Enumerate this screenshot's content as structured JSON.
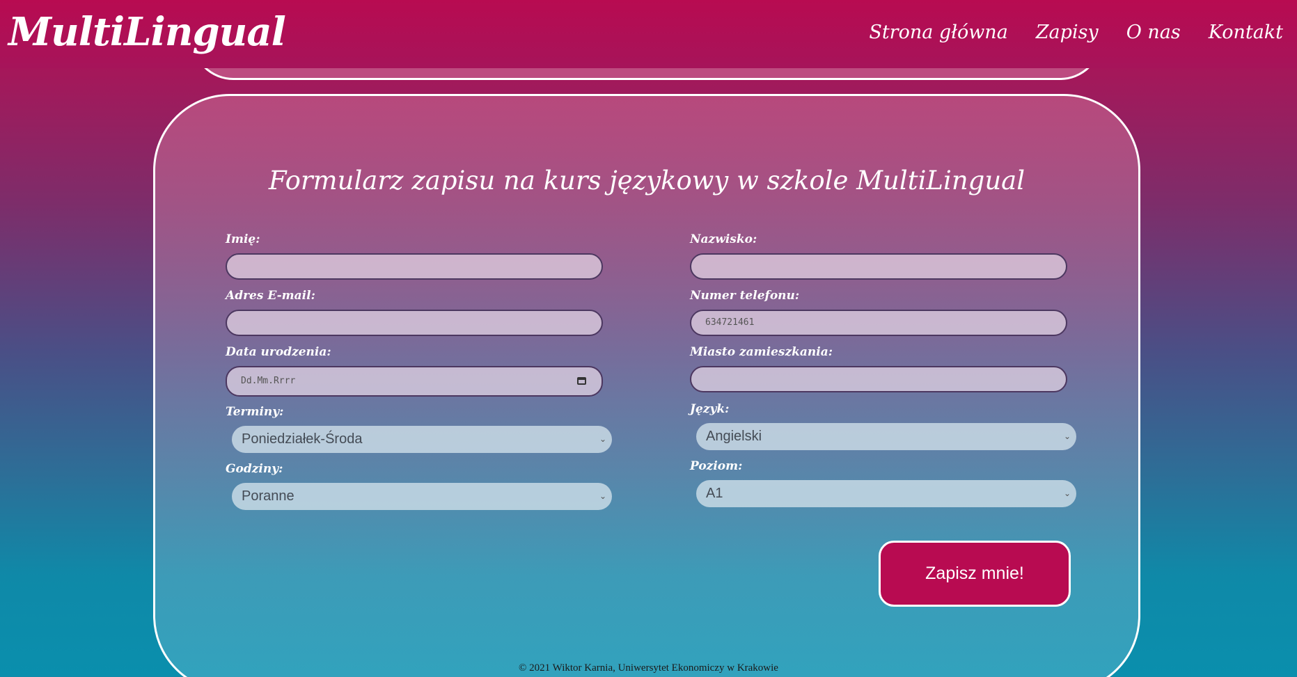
{
  "header": {
    "logo": "MultiLingual",
    "nav": [
      "Strona główna",
      "Zapisy",
      "O nas",
      "Kontakt"
    ]
  },
  "form": {
    "title": "Formularz zapisu na kurs językowy w szkole MultiLingual",
    "first_name": {
      "label": "Imię:",
      "value": ""
    },
    "last_name": {
      "label": "Nazwisko:",
      "value": ""
    },
    "email": {
      "label": "Adres E-mail:",
      "value": ""
    },
    "phone": {
      "label": "Numer telefonu:",
      "placeholder": "634721461"
    },
    "birth_date": {
      "label": "Data urodzenia:",
      "placeholder": "Dd.Mm.Rrrr"
    },
    "city": {
      "label": "Miasto zamieszkania:",
      "value": ""
    },
    "terms": {
      "label": "Terminy:",
      "selected": "Poniedziałek-Środa"
    },
    "language": {
      "label": "Język:",
      "selected": "Angielski"
    },
    "hours": {
      "label": "Godziny:",
      "selected": "Poranne"
    },
    "level": {
      "label": "Poziom:",
      "selected": "A1"
    },
    "submit_label": "Zapisz mnie!"
  },
  "footer": {
    "text": "© 2021 Wiktor Karnia, Uniwersytet Ekonomiczy w Krakowie"
  },
  "colors": {
    "brand": "#b80b51",
    "teal": "#0a8fad"
  },
  "icons": {
    "calendar": "calendar-icon",
    "select_arrow": "chevron-down-icon"
  }
}
